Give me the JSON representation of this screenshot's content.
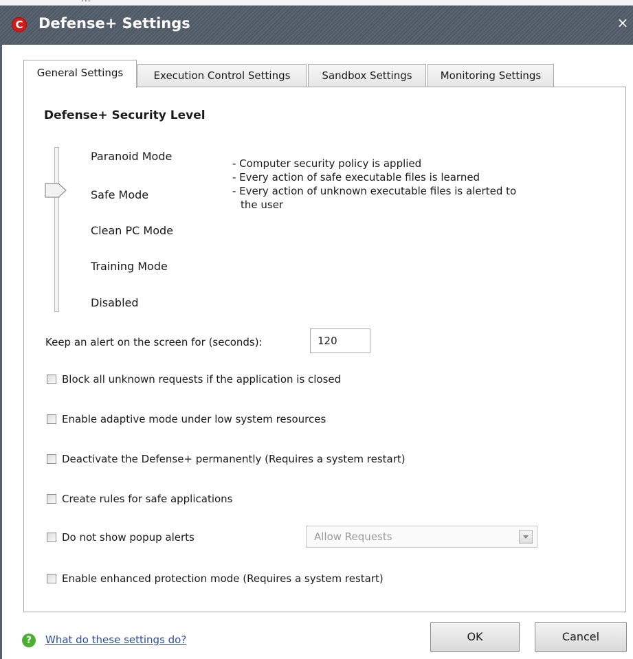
{
  "window": {
    "title": "Defense+ Settings",
    "close_glyph": "×",
    "logo_letter": "C"
  },
  "tabs": [
    {
      "label": "General Settings",
      "active": true
    },
    {
      "label": "Execution Control Settings",
      "active": false
    },
    {
      "label": "Sandbox Settings",
      "active": false
    },
    {
      "label": "Monitoring Settings",
      "active": false
    }
  ],
  "security_level": {
    "title": "Defense+ Security Level",
    "levels": [
      "Paranoid Mode",
      "Safe Mode",
      "Clean PC Mode",
      "Training Mode",
      "Disabled"
    ],
    "selected": "Safe Mode",
    "description": [
      "- Computer security policy is applied",
      "- Every action of safe executable files is learned",
      "- Every action of unknown executable files is alerted to",
      "the user"
    ]
  },
  "alert_timeout": {
    "label": "Keep an alert on the screen for (seconds):",
    "value": "120"
  },
  "checkboxes": [
    {
      "label": "Block all unknown requests if the application is closed",
      "checked": false
    },
    {
      "label": "Enable adaptive mode under low system resources",
      "checked": false
    },
    {
      "label": "Deactivate the Defense+ permanently (Requires a system restart)",
      "checked": false
    },
    {
      "label": "Create rules for safe applications",
      "checked": false
    },
    {
      "label": "Do not show popup alerts",
      "checked": false
    },
    {
      "label": "Enable enhanced protection mode (Requires a system restart)",
      "checked": false
    }
  ],
  "popup_select": {
    "value": "Allow Requests",
    "disabled": true
  },
  "footer": {
    "help_link": "What do these settings do?",
    "ok_label": "OK",
    "cancel_label": "Cancel"
  },
  "colors": {
    "titlebar": "#4f5966",
    "logo": "#d51a1a",
    "help_icon": "#4caf34",
    "link": "#2c4b9a"
  },
  "icons": {
    "app_logo": "comodo-logo-icon",
    "close": "close-icon",
    "help": "help-question-icon",
    "dropdown": "chevron-down-icon",
    "slider": "slider-thumb-icon"
  }
}
